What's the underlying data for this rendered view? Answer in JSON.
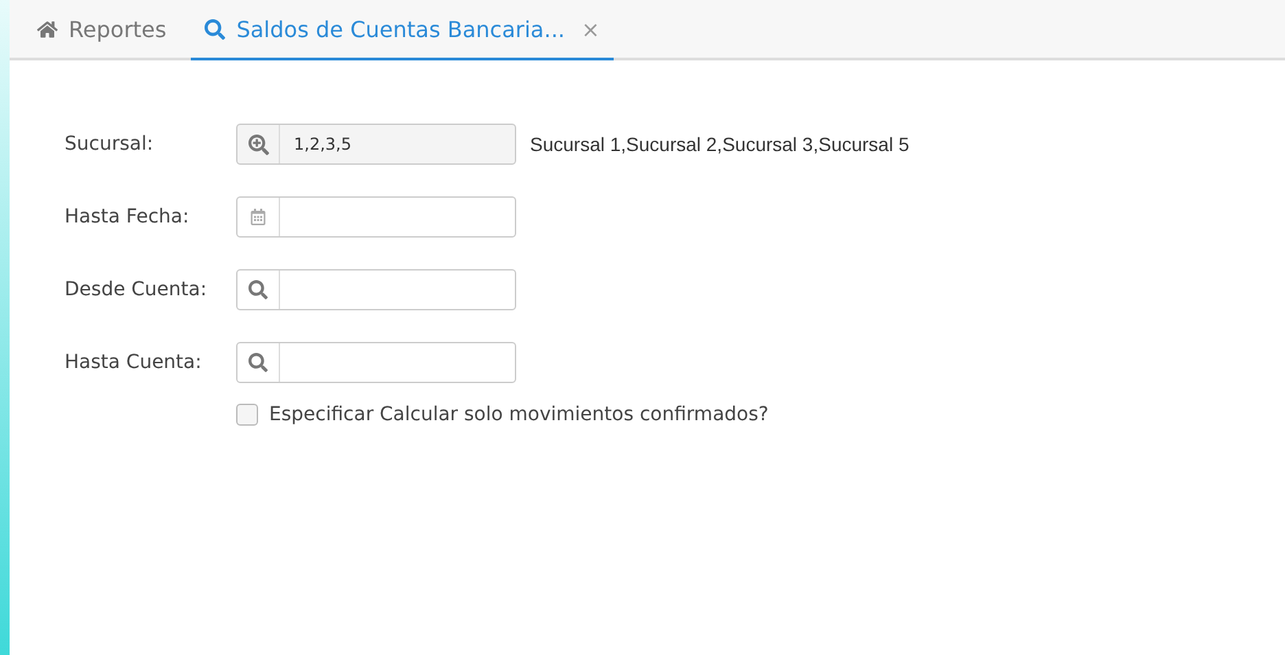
{
  "tabs": [
    {
      "kind": "home",
      "label": "Reportes",
      "selected": false
    },
    {
      "kind": "search",
      "label": "Saldos de Cuentas Bancaria...",
      "selected": true,
      "close": "×"
    }
  ],
  "form": {
    "fields": [
      {
        "label": "Sucursal:",
        "kind": "lookup",
        "value": "1,2,3,5",
        "description": "Sucursal 1,Sucursal 2,Sucursal 3,Sucursal 5"
      },
      {
        "label": "Hasta Fecha:",
        "kind": "date"
      },
      {
        "label": "Desde Cuenta:",
        "kind": "search"
      },
      {
        "label": "Hasta Cuenta:",
        "kind": "search"
      }
    ],
    "checkbox": {
      "label": "Especificar Calcular solo movimientos confirmados?",
      "checked": false
    }
  }
}
